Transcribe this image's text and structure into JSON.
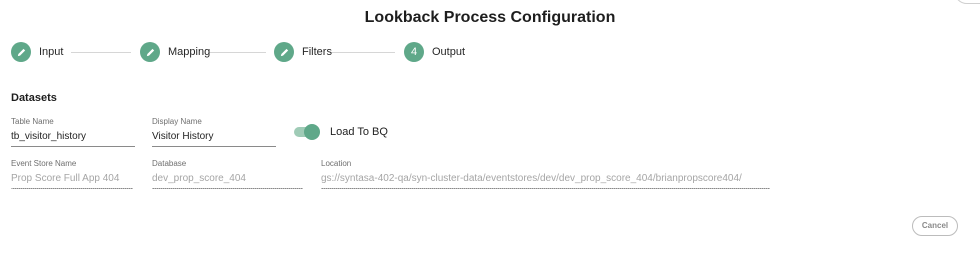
{
  "page": {
    "title": "Lookback Process Configuration"
  },
  "stepper": {
    "steps": [
      {
        "label": "Input",
        "state": "complete",
        "icon": "pencil-icon"
      },
      {
        "label": "Mapping",
        "state": "complete",
        "icon": "pencil-icon"
      },
      {
        "label": "Filters",
        "state": "complete",
        "icon": "pencil-icon"
      },
      {
        "label": "Output",
        "state": "active",
        "number": "4"
      }
    ],
    "accent_color": "#5fa889"
  },
  "datasets": {
    "section_title": "Datasets",
    "table_name": {
      "label": "Table Name",
      "value": "tb_visitor_history"
    },
    "display_name": {
      "label": "Display Name",
      "value": "Visitor History"
    },
    "load_to_bq": {
      "label": "Load To BQ",
      "checked": true
    },
    "event_store_name": {
      "label": "Event Store Name",
      "value": "Prop Score Full App 404"
    },
    "database": {
      "label": "Database",
      "value": "dev_prop_score_404"
    },
    "location": {
      "label": "Location",
      "value": "gs://syntasa-402-qa/syn-cluster-data/eventstores/dev/dev_prop_score_404/brianpropscore404/"
    }
  },
  "actions": {
    "cancel_label": "Cancel"
  }
}
